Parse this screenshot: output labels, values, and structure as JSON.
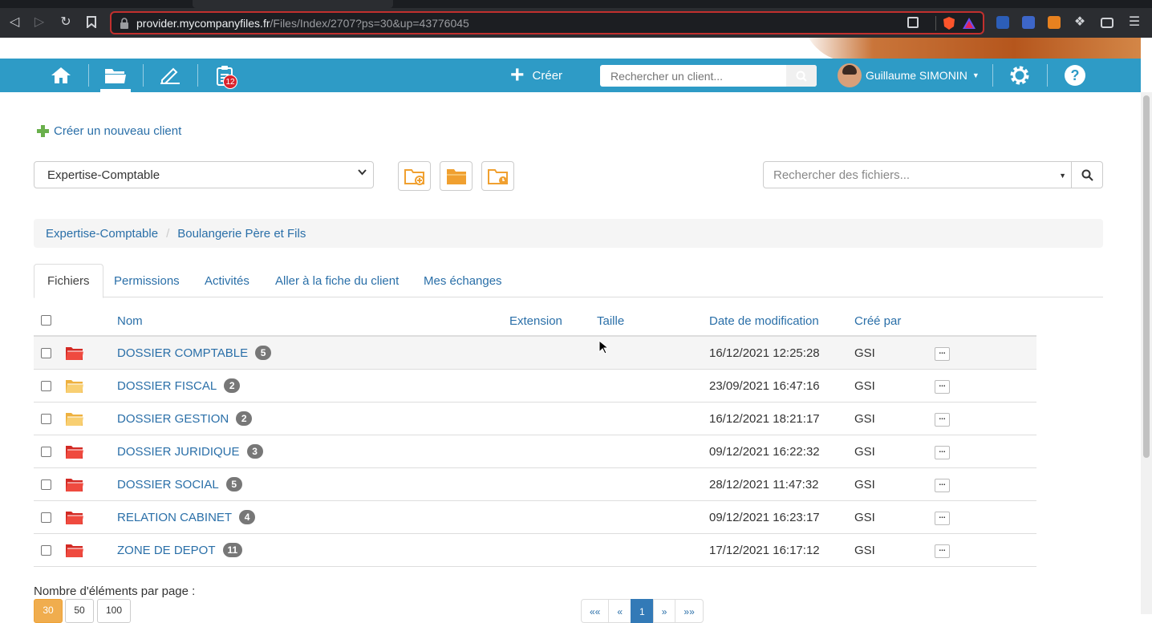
{
  "browser": {
    "url_host": "provider.mycompanyfiles.fr",
    "url_path": "/Files/Index/2707?ps=30&up=43776045"
  },
  "navbar": {
    "create_label": "Créer",
    "client_search_placeholder": "Rechercher un client...",
    "notification_count": "12",
    "user_name": "Guillaume SIMONIN",
    "color": "#2e9bc6"
  },
  "main": {
    "new_client_link": "Créer un nouveau client",
    "client_select_value": "Expertise-Comptable",
    "file_search_placeholder": "Rechercher des fichiers...",
    "breadcrumb": [
      "Expertise-Comptable",
      "Boulangerie Père et Fils"
    ],
    "tabs": [
      "Fichiers",
      "Permissions",
      "Activités",
      "Aller à la fiche du client",
      "Mes échanges"
    ],
    "table": {
      "headers": [
        "Nom",
        "Extension",
        "Taille",
        "Date de modification",
        "Créé par"
      ],
      "more_label": "...",
      "rows": [
        {
          "name": "DOSSIER COMPTABLE",
          "count": "5",
          "date": "16/12/2021 12:25:28",
          "by": "GSI",
          "folder_color": "red"
        },
        {
          "name": "DOSSIER FISCAL",
          "count": "2",
          "date": "23/09/2021 16:47:16",
          "by": "GSI",
          "folder_color": "yellow"
        },
        {
          "name": "DOSSIER GESTION",
          "count": "2",
          "date": "16/12/2021 18:21:17",
          "by": "GSI",
          "folder_color": "yellow"
        },
        {
          "name": "DOSSIER JURIDIQUE",
          "count": "3",
          "date": "09/12/2021 16:22:32",
          "by": "GSI",
          "folder_color": "red"
        },
        {
          "name": "DOSSIER SOCIAL",
          "count": "5",
          "date": "28/12/2021 11:47:32",
          "by": "GSI",
          "folder_color": "red"
        },
        {
          "name": "RELATION CABINET",
          "count": "4",
          "date": "09/12/2021 16:23:17",
          "by": "GSI",
          "folder_color": "red"
        },
        {
          "name": "ZONE DE DEPOT",
          "count": "11",
          "date": "17/12/2021 16:17:12",
          "by": "GSI",
          "folder_color": "red"
        }
      ]
    },
    "per_page_label": "Nombre d'éléments par page :",
    "per_page_options": [
      "30",
      "50",
      "100"
    ],
    "pagination": [
      "««",
      "«",
      "1",
      "»",
      "»»"
    ]
  }
}
